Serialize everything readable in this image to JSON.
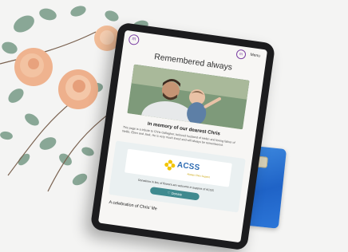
{
  "header": {
    "logo_letter": "m",
    "menu_icon_letter": "m",
    "menu_label": "Menu"
  },
  "page": {
    "title": "Remembered always",
    "memory_heading": "In memory of our dearest Chris",
    "memory_text": "This page is a tribute to Chris Gallagher, beloved husband of Helen and loving father of Nellie, Eben and Jack. He is very much loved and will always be remembered."
  },
  "donation": {
    "charity_name": "ACSS",
    "charity_subtitle": "Always Chris Support",
    "donations_text": "Donations in lieu of flowers are welcome in support of ACSS",
    "donate_label": "♡ Donate"
  },
  "celebration": {
    "heading": "A celebration of Chris' life"
  },
  "colors": {
    "brand_purple": "#7b3fa3",
    "button_teal": "#3f8a8f",
    "panel_bg": "#eaf0f1",
    "charity_blue": "#2f6db3"
  }
}
